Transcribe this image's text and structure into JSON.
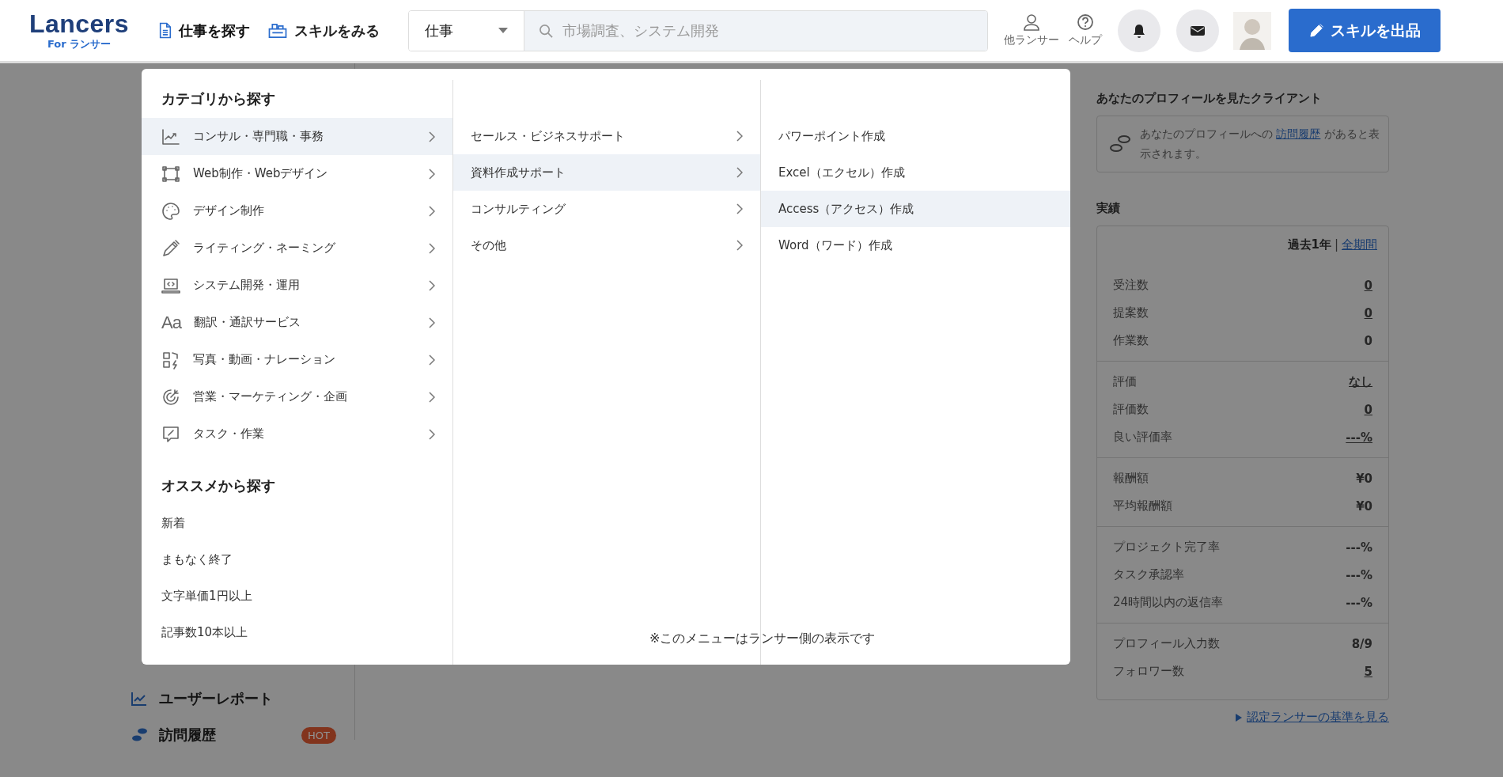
{
  "header": {
    "logo": {
      "name": "Lancers",
      "sub": "For ランサー"
    },
    "nav": [
      {
        "label": "仕事を探す",
        "expanded": true
      },
      {
        "label": "スキルをみる",
        "expanded": false
      }
    ],
    "search": {
      "category": "仕事",
      "placeholder": "市場調査、システム開発"
    },
    "utilities": [
      "他ランサー",
      "ヘルプ"
    ],
    "action_button": "スキルを出品"
  },
  "menu": {
    "categories": {
      "heading": "カテゴリから探す",
      "items": [
        {
          "label": "コンサル・専門職・事務",
          "selected": true
        },
        {
          "label": "Web制作・Webデザイン",
          "selected": false
        },
        {
          "label": "デザイン制作",
          "selected": false
        },
        {
          "label": "ライティング・ネーミング",
          "selected": false
        },
        {
          "label": "システム開発・運用",
          "selected": false
        },
        {
          "label": "翻訳・通訳サービス",
          "glyph": "Aa",
          "selected": false
        },
        {
          "label": "写真・動画・ナレーション",
          "selected": false
        },
        {
          "label": "営業・マーケティング・企画",
          "selected": false
        },
        {
          "label": "タスク・作業",
          "selected": false
        }
      ]
    },
    "recommended": {
      "heading": "オススメから探す",
      "items": [
        "新着",
        "まもなく終了",
        "文字単価1円以上",
        "記事数10本以上"
      ]
    },
    "subcategories": [
      {
        "label": "セールス・ビジネスサポート",
        "selected": false
      },
      {
        "label": "資料作成サポート",
        "selected": true
      },
      {
        "label": "コンサルティング",
        "selected": false
      },
      {
        "label": "その他",
        "selected": false
      }
    ],
    "leaf_items": [
      {
        "label": "パワーポイント作成",
        "selected": false
      },
      {
        "label": "Excel（エクセル）作成",
        "selected": false
      },
      {
        "label": "Access（アクセス）作成",
        "selected": true
      },
      {
        "label": "Word（ワード）作成",
        "selected": false
      }
    ],
    "note": "※このメニューはランサー側の表示です"
  },
  "sidebar": {
    "items": [
      {
        "label": "ユーザーレポート"
      },
      {
        "label": "訪問履歴",
        "badge": "HOT"
      }
    ]
  },
  "right_panel": {
    "visitors": {
      "heading": "あなたのプロフィールを見たクライアント",
      "text_before": "あなたのプロフィールへの",
      "link": "訪問履歴",
      "text_after": "があると表示されます。"
    },
    "stats": {
      "heading": "実績",
      "period": "過去1年",
      "separator": "|",
      "period_link": "全期間",
      "groups": [
        [
          {
            "label": "受注数",
            "value": "0",
            "linked": true
          },
          {
            "label": "提案数",
            "value": "0",
            "linked": true
          },
          {
            "label": "作業数",
            "value": "0",
            "linked": false
          }
        ],
        [
          {
            "label": "評価",
            "value": "なし",
            "linked": true
          },
          {
            "label": "評価数",
            "value": "0",
            "linked": true
          },
          {
            "label": "良い評価率",
            "value": "---%",
            "linked": true
          }
        ],
        [
          {
            "label": "報酬額",
            "value": "¥0",
            "linked": false
          },
          {
            "label": "平均報酬額",
            "value": "¥0",
            "linked": false
          }
        ],
        [
          {
            "label": "プロジェクト完了率",
            "value": "---%",
            "linked": false
          },
          {
            "label": "タスク承認率",
            "value": "---%",
            "linked": false
          },
          {
            "label": "24時間以内の返信率",
            "value": "---%",
            "linked": false
          }
        ],
        [
          {
            "label": "プロフィール入力数",
            "value": "8/9",
            "linked": false
          },
          {
            "label": "フォロワー数",
            "value": "5",
            "linked": true
          }
        ]
      ]
    },
    "footer_link": "認定ランサーの基準を見る"
  }
}
